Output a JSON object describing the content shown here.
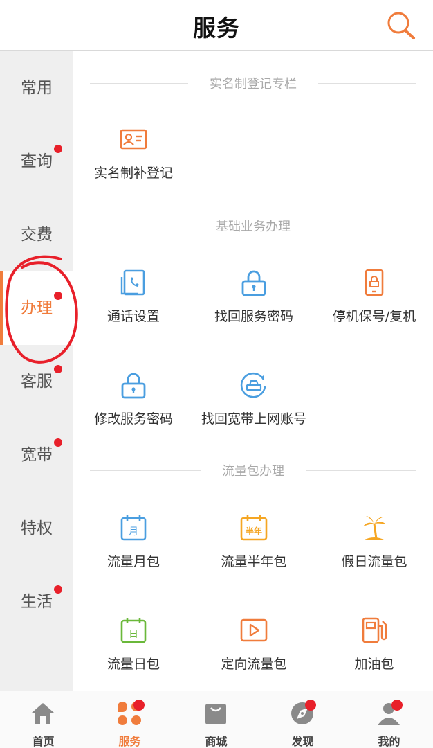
{
  "header": {
    "title": "服务",
    "search_icon": "search-icon"
  },
  "colors": {
    "accent": "#f07c3c",
    "blue": "#4a9ee0",
    "yellow": "#f5a623",
    "green": "#6ab83a",
    "badge": "#e8202a"
  },
  "sidebar": {
    "items": [
      {
        "label": "常用",
        "dot": false,
        "active": false
      },
      {
        "label": "查询",
        "dot": true,
        "active": false
      },
      {
        "label": "交费",
        "dot": false,
        "active": false
      },
      {
        "label": "办理",
        "dot": true,
        "active": true
      },
      {
        "label": "客服",
        "dot": true,
        "active": false
      },
      {
        "label": "宽带",
        "dot": true,
        "active": false
      },
      {
        "label": "特权",
        "dot": false,
        "active": false
      },
      {
        "label": "生活",
        "dot": true,
        "active": false
      }
    ]
  },
  "sections": [
    {
      "title": "实名制登记专栏",
      "items": [
        {
          "label": "实名制补登记",
          "icon": "id-card-icon"
        }
      ]
    },
    {
      "title": "基础业务办理",
      "items": [
        {
          "label": "通话设置",
          "icon": "call-settings-icon"
        },
        {
          "label": "找回服务密码",
          "icon": "lock-icon"
        },
        {
          "label": "停机保号/复机",
          "icon": "phone-lock-icon"
        },
        {
          "label": "修改服务密码",
          "icon": "lock-icon"
        },
        {
          "label": "找回宽带上网账号",
          "icon": "broadband-icon"
        }
      ]
    },
    {
      "title": "流量包办理",
      "items": [
        {
          "label": "流量月包",
          "icon": "calendar-month-icon",
          "badge": "月"
        },
        {
          "label": "流量半年包",
          "icon": "calendar-half-year-icon",
          "badge": "半年"
        },
        {
          "label": "假日流量包",
          "icon": "palm-tree-icon"
        },
        {
          "label": "流量日包",
          "icon": "calendar-day-icon",
          "badge": "日"
        },
        {
          "label": "定向流量包",
          "icon": "play-icon"
        },
        {
          "label": "加油包",
          "icon": "fuel-pump-icon"
        }
      ]
    }
  ],
  "tabbar": {
    "items": [
      {
        "label": "首页",
        "icon": "home-icon"
      },
      {
        "label": "服务",
        "icon": "service-grid-icon"
      },
      {
        "label": "商城",
        "icon": "shopping-bag-icon"
      },
      {
        "label": "发现",
        "icon": "compass-icon"
      },
      {
        "label": "我的",
        "icon": "user-icon"
      }
    ]
  }
}
